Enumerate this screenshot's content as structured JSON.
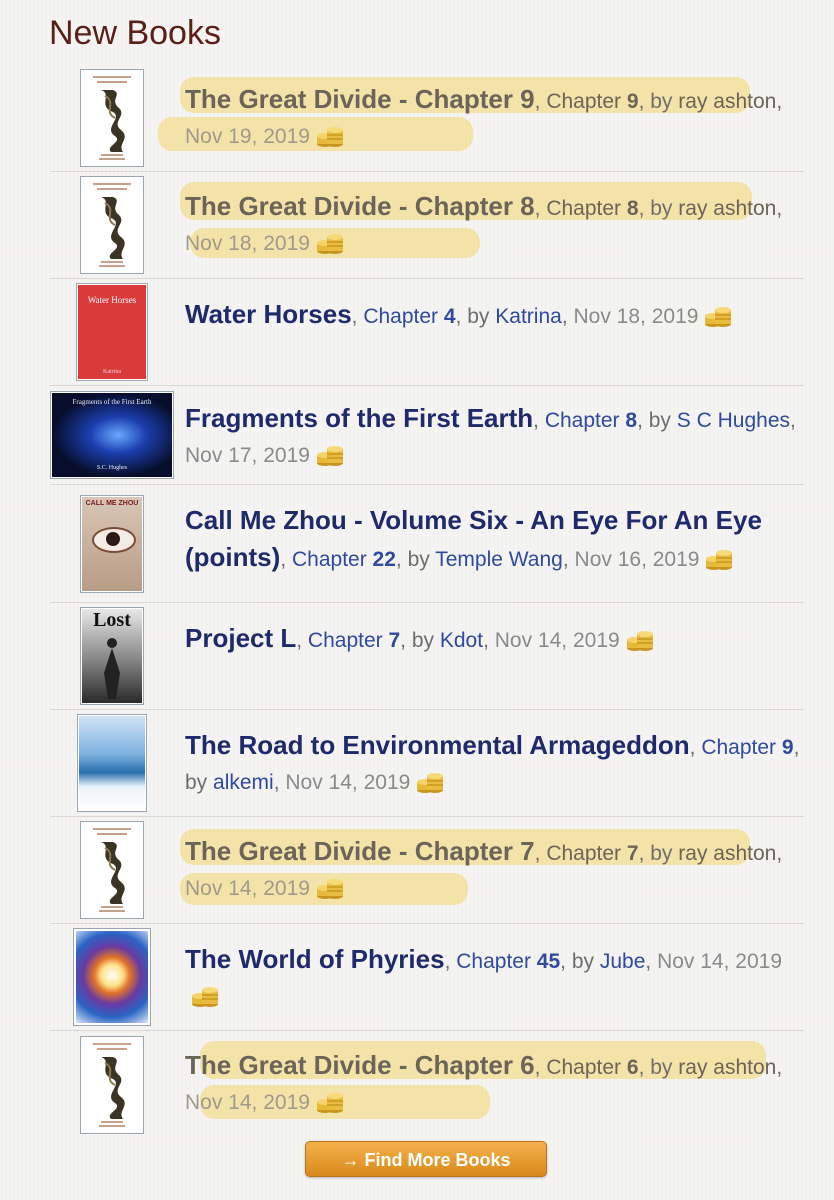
{
  "heading": "New Books",
  "books": [
    {
      "title": "The Great Divide - Chapter 9",
      "chapter_label": "Chapter",
      "chapter": "9",
      "by": "by",
      "author": "ray ashton",
      "date": "Nov 19, 2019",
      "highlighted": true
    },
    {
      "title": "The Great Divide - Chapter 8",
      "chapter_label": "Chapter",
      "chapter": "8",
      "by": "by",
      "author": "ray ashton",
      "date": "Nov 18, 2019",
      "highlighted": true
    },
    {
      "title": "Water Horses",
      "chapter_label": "Chapter",
      "chapter": "4",
      "by": "by",
      "author": "Katrina",
      "date": "Nov 18, 2019",
      "highlighted": false,
      "cover_text": "Water Horses",
      "cover_sub": "Katrina"
    },
    {
      "title": "Fragments of the First Earth",
      "chapter_label": "Chapter",
      "chapter": "8",
      "by": "by",
      "author": "S C Hughes",
      "date": "Nov 17, 2019",
      "highlighted": false,
      "cover_text": "Fragments of the First Earth",
      "cover_sub": "S.C. Hughes"
    },
    {
      "title": "Call Me Zhou - Volume Six - An Eye For An Eye (points)",
      "chapter_label": "Chapter",
      "chapter": "22",
      "by": "by",
      "author": "Temple Wang",
      "date": "Nov 16, 2019",
      "highlighted": false,
      "cover_text": "CALL ME ZHOU"
    },
    {
      "title": "Project L",
      "chapter_label": "Chapter",
      "chapter": "7",
      "by": "by",
      "author": "Kdot",
      "date": "Nov 14, 2019",
      "highlighted": false,
      "cover_text": "Lost"
    },
    {
      "title": "The Road to Environmental Armageddon",
      "chapter_label": "Chapter",
      "chapter": "9",
      "by": "by",
      "author": "alkemi",
      "date": "Nov 14, 2019",
      "highlighted": false
    },
    {
      "title": "The Great Divide - Chapter 7",
      "chapter_label": "Chapter",
      "chapter": "7",
      "by": "by",
      "author": "ray ashton",
      "date": "Nov 14, 2019",
      "highlighted": true
    },
    {
      "title": "The World of Phyries",
      "chapter_label": "Chapter",
      "chapter": "45",
      "by": "by",
      "author": "Jube",
      "date": "Nov 14, 2019",
      "highlighted": false
    },
    {
      "title": "The Great Divide - Chapter 6",
      "chapter_label": "Chapter",
      "chapter": "6",
      "by": "by",
      "author": "ray ashton",
      "date": "Nov 14, 2019",
      "highlighted": true
    }
  ],
  "find_more_button": "→ Find More Books",
  "colors": {
    "heading": "#5a1f17",
    "title": "#1e2a6b",
    "link": "#2f4a9e",
    "highlight": "#f4d050",
    "button": "#e9a030"
  },
  "icons": {
    "points": "gold-coins-icon"
  }
}
